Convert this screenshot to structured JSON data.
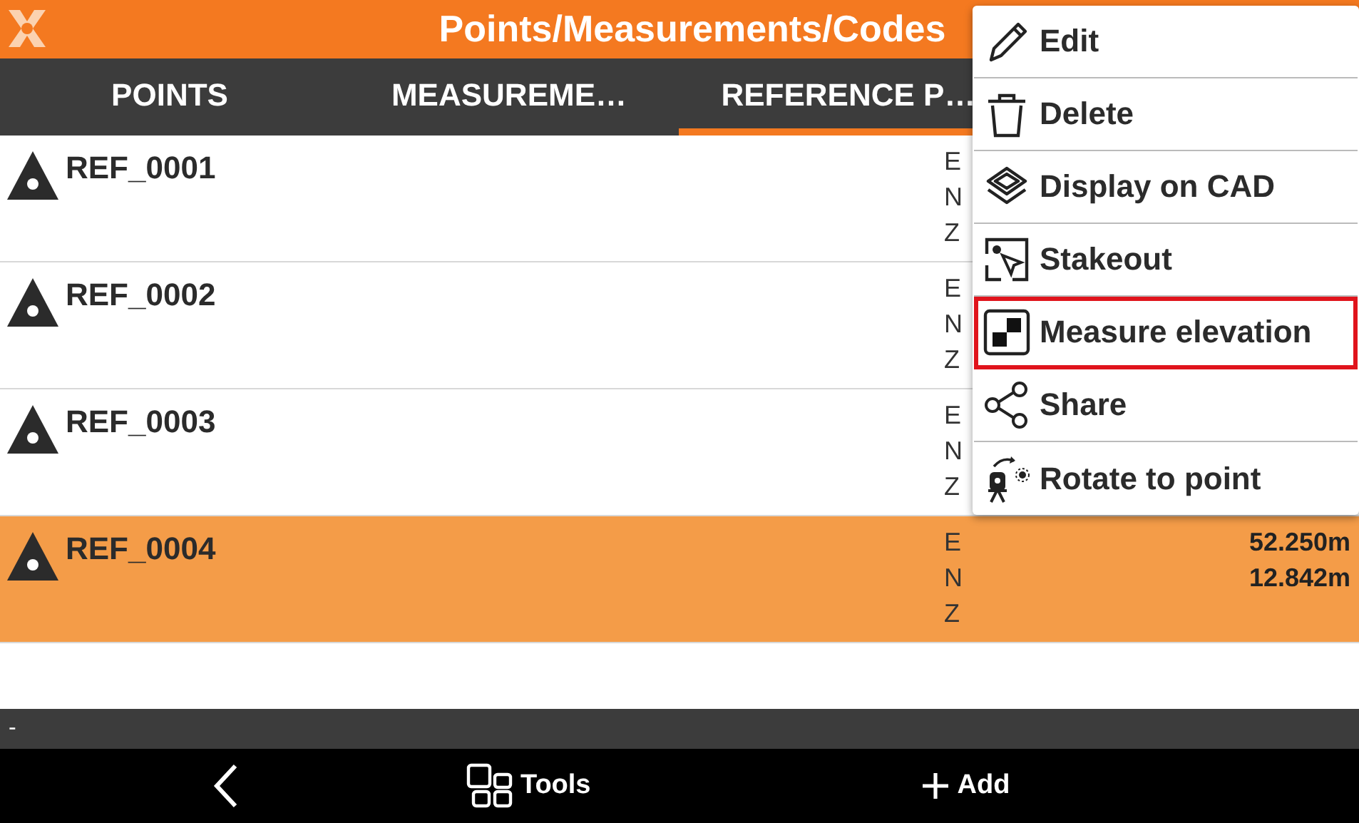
{
  "header": {
    "title": "Points/Measurements/Codes"
  },
  "tabs": [
    {
      "label": "POINTS",
      "selected": false
    },
    {
      "label": "MEASUREME…",
      "selected": false
    },
    {
      "label": "REFERENCE P…",
      "selected": true
    }
  ],
  "rows": [
    {
      "name": "REF_0001",
      "selected": false,
      "coords": [
        {
          "axis": "E"
        },
        {
          "axis": "N"
        },
        {
          "axis": "Z"
        }
      ]
    },
    {
      "name": "REF_0002",
      "selected": false,
      "coords": [
        {
          "axis": "E"
        },
        {
          "axis": "N"
        },
        {
          "axis": "Z"
        }
      ]
    },
    {
      "name": "REF_0003",
      "selected": false,
      "coords": [
        {
          "axis": "E"
        },
        {
          "axis": "N"
        },
        {
          "axis": "Z"
        }
      ]
    },
    {
      "name": "REF_0004",
      "selected": true,
      "coords": [
        {
          "axis": "E",
          "value": "52.250m"
        },
        {
          "axis": "N",
          "value": "12.842m"
        },
        {
          "axis": "Z"
        }
      ]
    }
  ],
  "status_bar": {
    "text": "-"
  },
  "bottom_bar": [
    {
      "kind": "back"
    },
    {
      "kind": "tools",
      "label": "Tools"
    },
    {
      "kind": "add",
      "label": "Add"
    }
  ],
  "menu": [
    {
      "kind": "edit",
      "label": "Edit",
      "highlighted": false
    },
    {
      "kind": "delete",
      "label": "Delete",
      "highlighted": false
    },
    {
      "kind": "cad",
      "label": "Display on CAD",
      "highlighted": false
    },
    {
      "kind": "stakeout",
      "label": "Stakeout",
      "highlighted": false
    },
    {
      "kind": "elevation",
      "label": "Measure elevation",
      "highlighted": true
    },
    {
      "kind": "share",
      "label": "Share",
      "highlighted": false
    },
    {
      "kind": "rotate",
      "label": "Rotate to point",
      "highlighted": false
    }
  ]
}
